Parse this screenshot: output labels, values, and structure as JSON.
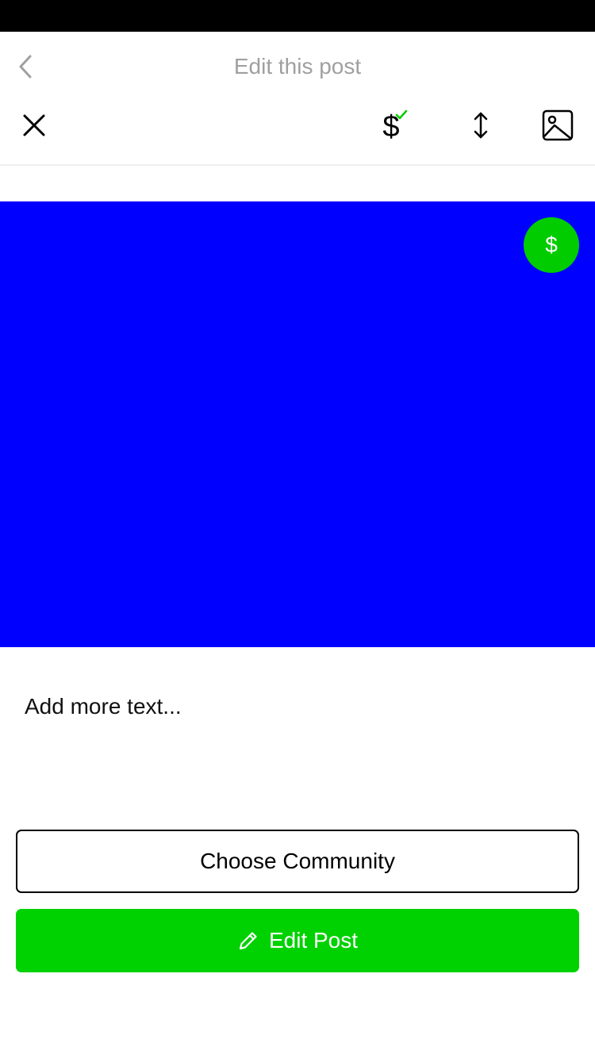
{
  "nav": {
    "title": "Edit this post",
    "back_icon": "chevron-left-icon"
  },
  "toolbar": {
    "close_icon": "close-icon",
    "paid_symbol": "$",
    "paid_check_icon": "check-icon",
    "resize_icon": "vertical-resize-icon",
    "image_icon": "image-icon"
  },
  "media": {
    "color": "#0000ff"
  },
  "badge": {
    "symbol": "$",
    "color": "#00cc00"
  },
  "editor": {
    "placeholder": "Add more text..."
  },
  "actions": {
    "choose_community_label": "Choose Community",
    "edit_post_label": "Edit Post",
    "edit_post_icon": "pencil-icon",
    "edit_post_color": "#00d100"
  },
  "colors": {
    "accent_green": "#00d100",
    "check_green": "#00cc00",
    "title_gray": "#a0a0a0"
  }
}
